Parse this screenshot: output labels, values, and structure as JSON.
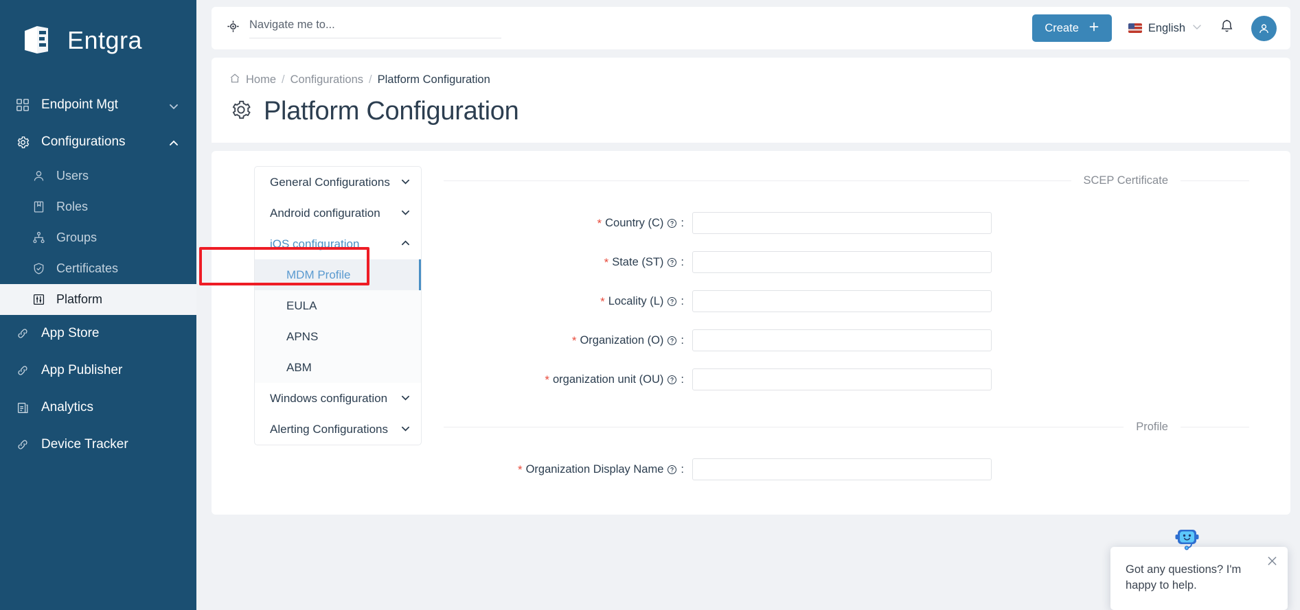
{
  "brand": {
    "name": "Entgra"
  },
  "sidebar": {
    "items": [
      {
        "label": "Endpoint Mgt",
        "icon": "grid-icon",
        "type": "top",
        "expandable": true,
        "expanded": false,
        "active": false
      },
      {
        "label": "Configurations",
        "icon": "gear-icon",
        "type": "top",
        "expandable": true,
        "expanded": true,
        "active": false
      },
      {
        "label": "Users",
        "icon": "user-icon",
        "type": "sub",
        "active": false
      },
      {
        "label": "Roles",
        "icon": "book-icon",
        "type": "sub",
        "active": false
      },
      {
        "label": "Groups",
        "icon": "sitemap-icon",
        "type": "sub",
        "active": false
      },
      {
        "label": "Certificates",
        "icon": "shield-check-icon",
        "type": "sub",
        "active": false
      },
      {
        "label": "Platform",
        "icon": "sliders-icon",
        "type": "sub",
        "active": true
      },
      {
        "label": "App Store",
        "icon": "link-icon",
        "type": "top",
        "active": false
      },
      {
        "label": "App Publisher",
        "icon": "link-icon",
        "type": "top",
        "active": false
      },
      {
        "label": "Analytics",
        "icon": "clipboard-icon",
        "type": "top",
        "active": false
      },
      {
        "label": "Device Tracker",
        "icon": "link-icon",
        "type": "top",
        "active": false
      }
    ]
  },
  "topbar": {
    "search": {
      "placeholder": "Navigate me to...",
      "value": "",
      "icon": "navigate-target-icon"
    },
    "create_label": "Create",
    "create_icon": "plus-icon",
    "language": "English",
    "language_chevron": "chevron-down-icon",
    "notification_icon": "bell-icon",
    "avatar_icon": "user-avatar-icon",
    "accent_color": "#3a86b8"
  },
  "breadcrumb": {
    "home": "Home",
    "level2": "Configurations",
    "current": "Platform Configuration",
    "separator": "/"
  },
  "page": {
    "title": "Platform Configuration",
    "icon": "gear-icon"
  },
  "accordion": {
    "groups": [
      {
        "label": "General Configurations",
        "open": false
      },
      {
        "label": "Android configuration",
        "open": false
      },
      {
        "label": "iOS configuration",
        "open": true,
        "children": [
          {
            "label": "MDM Profile",
            "selected": true
          },
          {
            "label": "EULA",
            "selected": false
          },
          {
            "label": "APNS",
            "selected": false
          },
          {
            "label": "ABM",
            "selected": false
          }
        ]
      },
      {
        "label": "Windows configuration",
        "open": false
      },
      {
        "label": "Alerting Configurations",
        "open": false
      }
    ]
  },
  "form": {
    "sections": [
      {
        "title": "SCEP Certificate",
        "fields": [
          {
            "label": "Country (C)",
            "required": true,
            "value": "",
            "help": "help-icon"
          },
          {
            "label": "State (ST)",
            "required": true,
            "value": "",
            "help": "help-icon"
          },
          {
            "label": "Locality (L)",
            "required": true,
            "value": "",
            "help": "help-icon"
          },
          {
            "label": "Organization (O)",
            "required": true,
            "value": "",
            "help": "help-icon"
          },
          {
            "label": "organization unit (OU)",
            "required": true,
            "value": "",
            "help": "help-icon"
          }
        ]
      },
      {
        "title": "Profile",
        "fields": [
          {
            "label": "Organization Display Name",
            "required": true,
            "value": "",
            "help": "help-icon"
          }
        ]
      }
    ],
    "required_marker": "*",
    "label_suffix": ":"
  },
  "chat": {
    "message": "Got any questions? I'm happy to help.",
    "close_icon": "close-icon",
    "avatar_icon": "chat-bot-icon"
  },
  "annotation": {
    "highlight_color": "#ee1c25",
    "target": "MDM Profile"
  }
}
